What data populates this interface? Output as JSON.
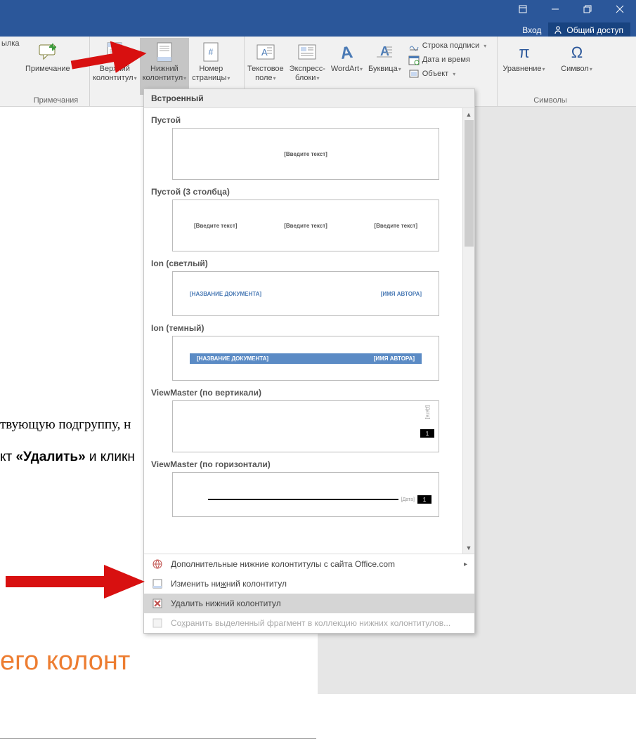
{
  "titlebar": {
    "login": "Вход",
    "share": "Общий доступ"
  },
  "ribbon": {
    "ssylka": "ылка",
    "comment": "Примечание",
    "comments_group": "Примечания",
    "header": "Верхний\nколонтитул",
    "footer": "Нижний\nколонтитул",
    "page_number": "Номер\nстраницы",
    "text_box": "Текстовое\nполе",
    "quick_parts": "Экспресс-\nблоки",
    "wordart": "WordArt",
    "drop_cap": "Буквица",
    "signature_line": "Строка подписи",
    "date_time": "Дата и время",
    "object": "Объект",
    "equation": "Уравнение",
    "symbol": "Символ",
    "symbols_group": "Символы"
  },
  "gallery": {
    "builtin": "Встроенный",
    "templates": [
      {
        "name": "Пустой",
        "ph": "[Введите текст]"
      },
      {
        "name": "Пустой (3 столбца)",
        "ph": "[Введите текст]"
      },
      {
        "name": "Ion (светлый)",
        "left": "[НАЗВАНИЕ ДОКУМЕНТА]",
        "right": "[ИМЯ АВТОРА]"
      },
      {
        "name": "Ion (темный)",
        "left": "[НАЗВАНИЕ ДОКУМЕНТА]",
        "right": "[ИМЯ АВТОРА]"
      },
      {
        "name": "ViewMaster (по вертикали)",
        "date": "[Дата]",
        "page": "1"
      },
      {
        "name": "ViewMaster (по горизонтали)",
        "date": "[Дата]",
        "page": "1"
      }
    ],
    "footer_items": {
      "more_office": "Дополнительные нижние колонтитулы с сайта Office.com",
      "edit": "Изменить нижний колонтитул",
      "remove": "Удалить нижний колонтитул",
      "save_selection": "Сохранить выделенный фрагмент в коллекцию нижних колонтитулов..."
    }
  },
  "doc": {
    "line1": "твующую подгруппу, н",
    "line2_a": "кт ",
    "line2_b": "«Удалить»",
    "line2_c": " и кликн",
    "heading": "его колонт"
  }
}
